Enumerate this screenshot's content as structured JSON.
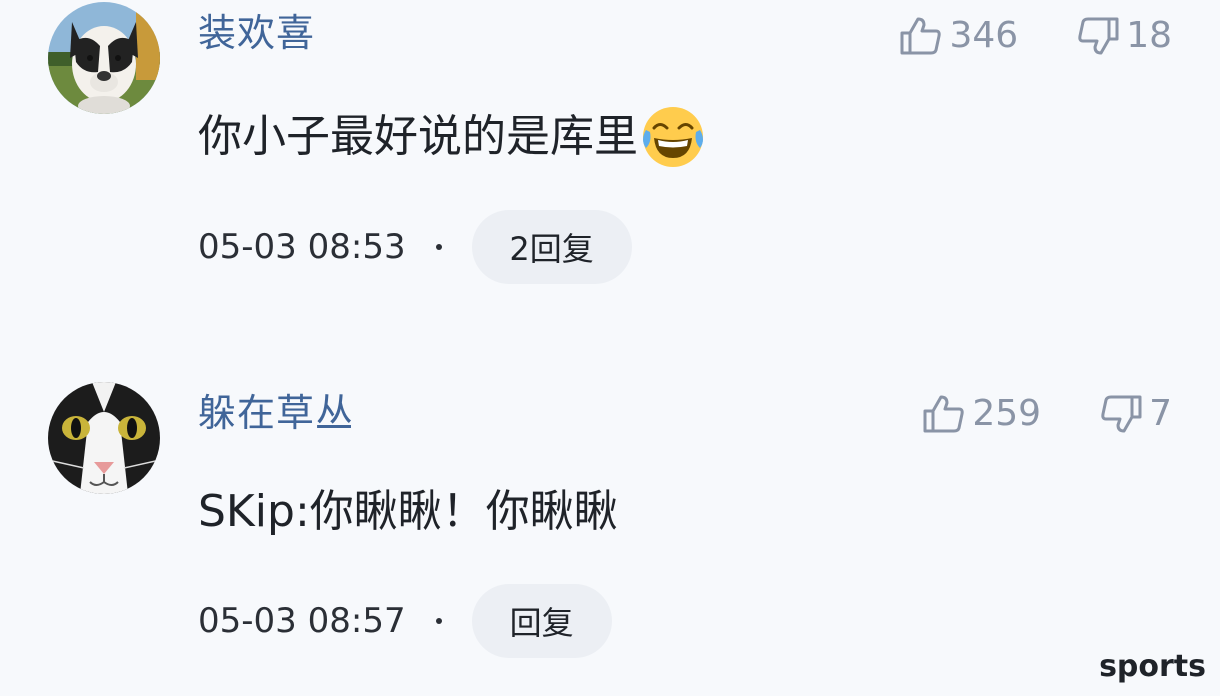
{
  "comments": [
    {
      "username": "装欢喜",
      "avatar_icon": "dog-avatar",
      "likes": "346",
      "dislikes": "18",
      "text": "你小子最好说的是库里",
      "emoji": "tears-of-joy-emoji",
      "timestamp": "05-03 08:53",
      "reply_label": "2回复"
    },
    {
      "username": "躲在草丛",
      "avatar_icon": "cat-avatar",
      "likes": "259",
      "dislikes": "7",
      "text": "SKip:你瞅瞅！你瞅瞅",
      "timestamp": "05-03 08:57",
      "reply_label": "回复"
    }
  ],
  "watermark": "sports",
  "colors": {
    "background": "#f7f9fc",
    "username": "#406599",
    "vote": "#8a94a6",
    "reply_pill": "#eceff4"
  }
}
